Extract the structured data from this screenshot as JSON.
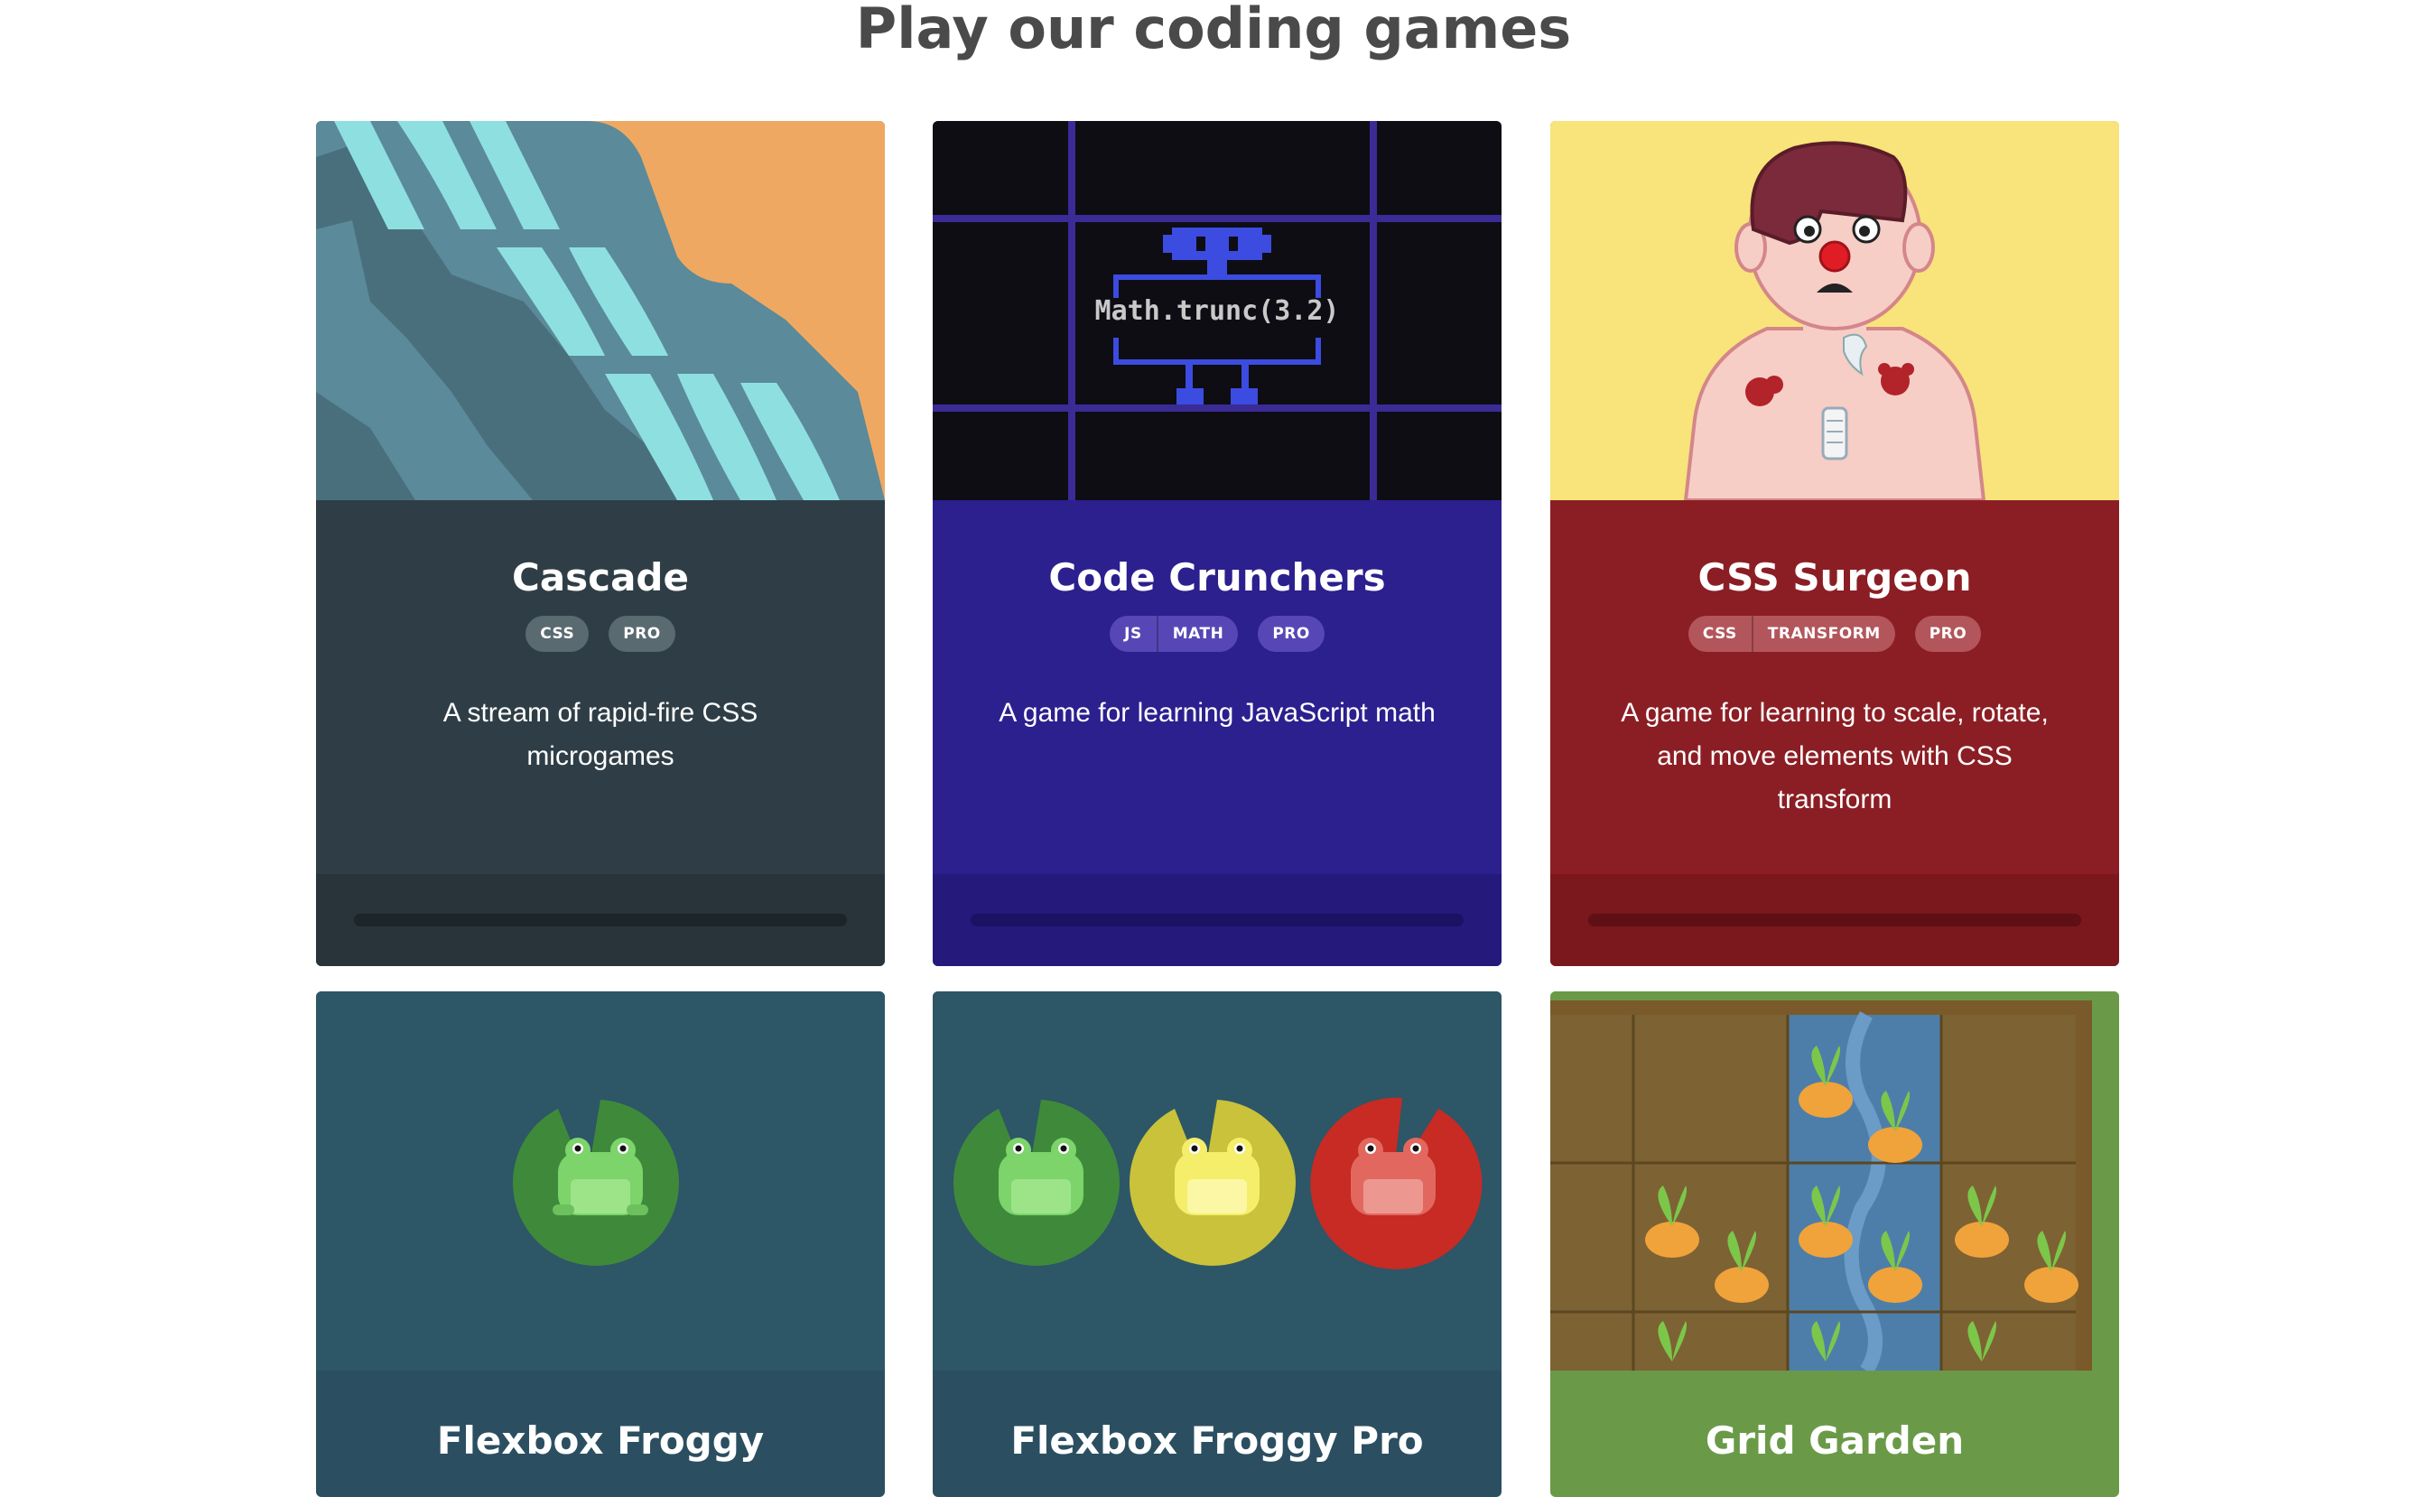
{
  "page": {
    "heading": "Play our coding games"
  },
  "cards": [
    {
      "title": "Cascade",
      "tags": [
        {
          "segments": [
            "CSS"
          ]
        },
        {
          "segments": [
            "PRO"
          ]
        }
      ],
      "description": "A stream of rapid-fire CSS microgames",
      "colors": {
        "body": "#2f3e46",
        "footer": "#283439",
        "track": "#1c2529",
        "tag": "#5a6a71"
      }
    },
    {
      "title": "Code Crunchers",
      "tags": [
        {
          "segments": [
            "JS",
            "MATH"
          ]
        },
        {
          "segments": [
            "PRO"
          ]
        }
      ],
      "description": "A game for learning JavaScript math",
      "art_text": "Math.trunc(3.2)",
      "colors": {
        "body": "#2c1f8e",
        "footer": "#25197c",
        "track": "#1b1262",
        "tag": "#5747b6"
      }
    },
    {
      "title": "CSS Surgeon",
      "tags": [
        {
          "segments": [
            "CSS",
            "TRANSFORM"
          ]
        },
        {
          "segments": [
            "PRO"
          ]
        }
      ],
      "description": "A game for learning to scale, rotate, and move elements with CSS transform",
      "colors": {
        "body": "#8b1e24",
        "footer": "#7a181e",
        "track": "#5e1014",
        "tag": "#b3565b"
      }
    },
    {
      "title": "Flexbox Froggy",
      "colors": {
        "body": "#2b4f61",
        "art_bg": "#2d5667"
      }
    },
    {
      "title": "Flexbox Froggy Pro",
      "colors": {
        "body": "#2b4f61",
        "art_bg": "#2d5667"
      }
    },
    {
      "title": "Grid Garden",
      "colors": {
        "body": "#6a9a48"
      }
    }
  ]
}
